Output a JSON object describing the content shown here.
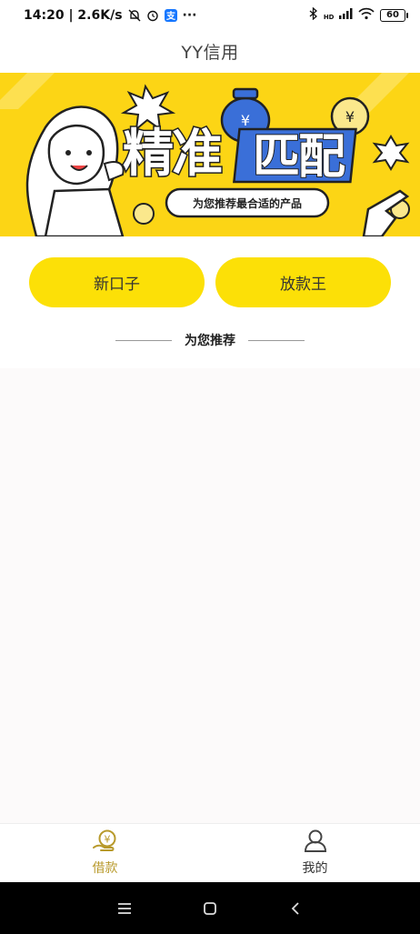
{
  "status_bar": {
    "time_speed": "14:20 | 2.6K/s",
    "battery": "60",
    "hd_label": "HD",
    "more": "···"
  },
  "header": {
    "title": "YY信用"
  },
  "banner": {
    "headline_1": "精准",
    "headline_2": "匹配",
    "subtitle": "为您推荐最合适的产品"
  },
  "quick_buttons": [
    {
      "label": "新口子"
    },
    {
      "label": "放款王"
    }
  ],
  "section": {
    "title": "为您推荐"
  },
  "tabbar": {
    "tabs": [
      {
        "label": "借款",
        "icon": "loan-hand-yen-icon",
        "active": true
      },
      {
        "label": "我的",
        "icon": "user-profile-icon",
        "active": false
      }
    ],
    "active_color": "#b89a2c"
  },
  "colors": {
    "accent": "#fce007",
    "banner_bg": "#fcd515"
  }
}
